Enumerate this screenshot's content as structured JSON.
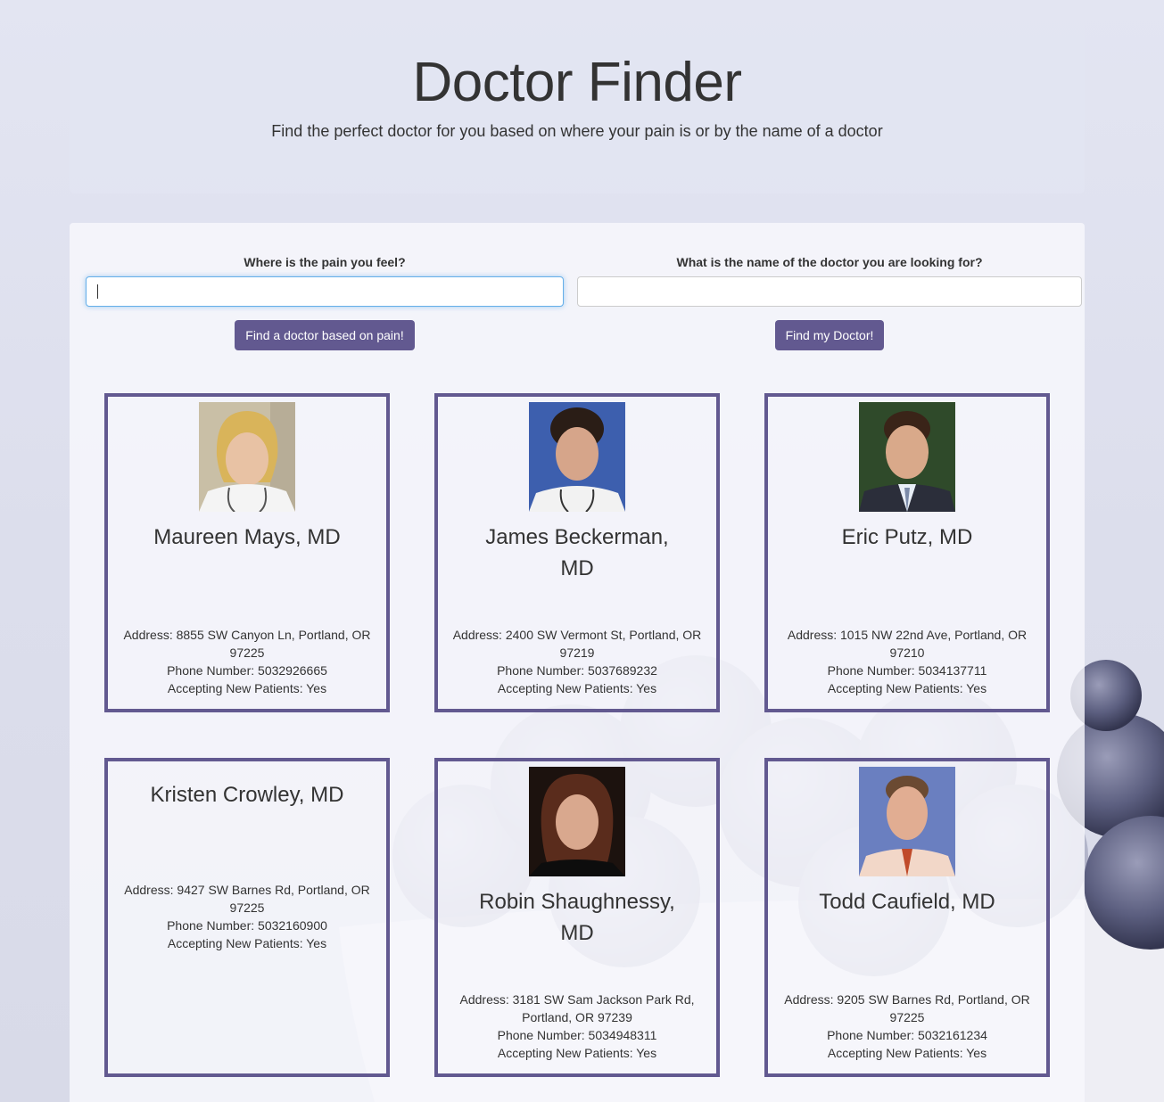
{
  "header": {
    "title": "Doctor Finder",
    "subtitle": "Find the perfect doctor for you based on where your pain is or by the name of a doctor"
  },
  "search": {
    "pain_label": "Where is the pain you feel?",
    "pain_value": "",
    "pain_button": "Find a doctor based on pain!",
    "name_label": "What is the name of the doctor you are looking for?",
    "name_value": "",
    "name_button": "Find my Doctor!"
  },
  "colors": {
    "accent": "#625990",
    "focus": "#66afe9"
  },
  "doctors": [
    {
      "name": "Maureen Mays, MD",
      "address": "Address: 8855 SW Canyon Ln, Portland, OR 97225",
      "phone": "Phone Number: 5032926665",
      "accepting": "Accepting New Patients: Yes",
      "photo": "portrait-photo"
    },
    {
      "name": "James Beckerman, MD",
      "address": "Address: 2400 SW Vermont St, Portland, OR 97219",
      "phone": "Phone Number: 5037689232",
      "accepting": "Accepting New Patients: Yes",
      "photo": "portrait-photo"
    },
    {
      "name": "Eric Putz, MD",
      "address": "Address: 1015 NW 22nd Ave, Portland, OR 97210",
      "phone": "Phone Number: 5034137711",
      "accepting": "Accepting New Patients: Yes",
      "photo": "portrait-photo"
    },
    {
      "name": "Kristen Crowley, MD",
      "address": "Address: 9427 SW Barnes Rd, Portland, OR 97225",
      "phone": "Phone Number: 5032160900",
      "accepting": "Accepting New Patients: Yes",
      "photo": ""
    },
    {
      "name": "Robin Shaughnessy, MD",
      "address": "Address: 3181 SW Sam Jackson Park Rd, Portland, OR 97239",
      "phone": "Phone Number: 5034948311",
      "accepting": "Accepting New Patients: Yes",
      "photo": "portrait-photo"
    },
    {
      "name": "Todd Caufield, MD",
      "address": "Address: 9205 SW Barnes Rd, Portland, OR 97225",
      "phone": "Phone Number: 5032161234",
      "accepting": "Accepting New Patients: Yes",
      "photo": "portrait-photo"
    }
  ]
}
